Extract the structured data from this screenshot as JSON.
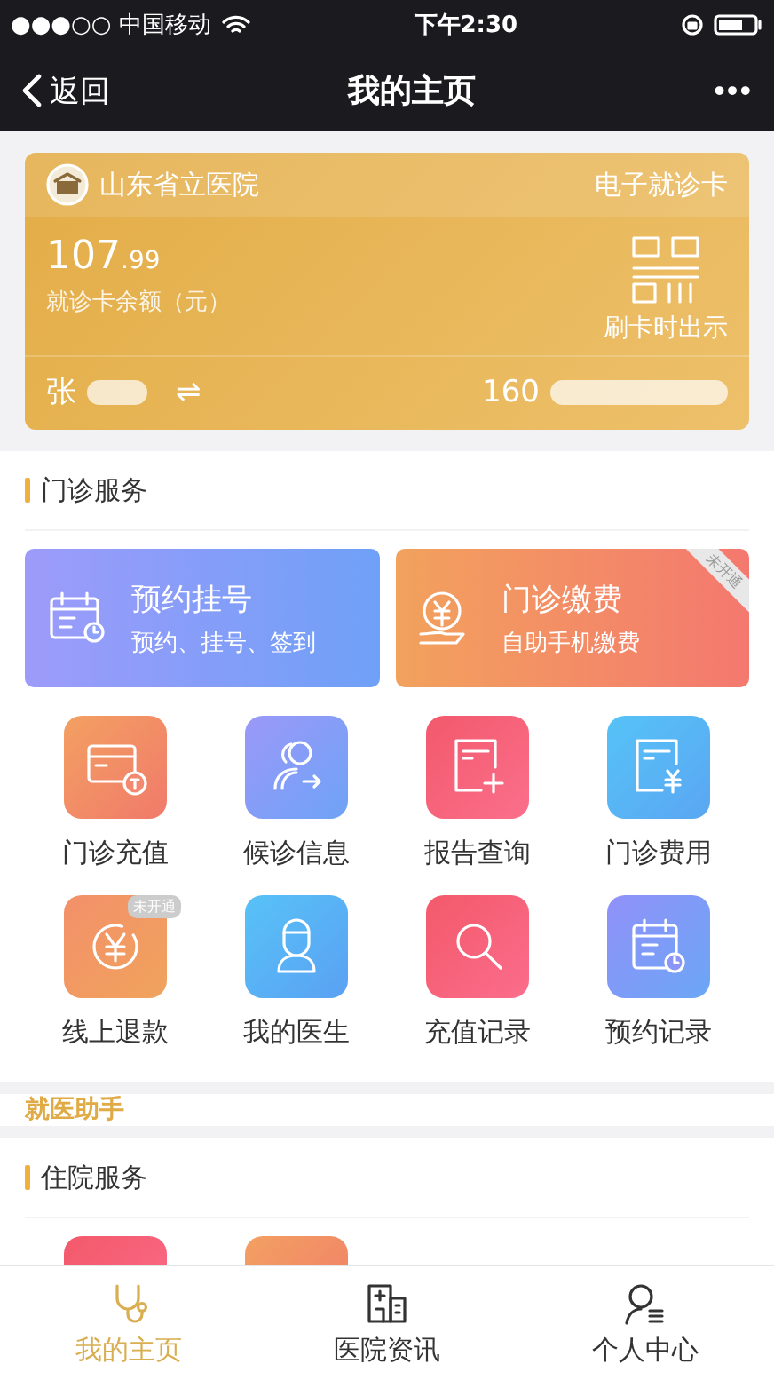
{
  "status_bar": {
    "carrier": "●●●○○ 中国移动",
    "time": "下午2:30"
  },
  "nav": {
    "back": "返回",
    "title": "我的主页",
    "more": "•••"
  },
  "card": {
    "hospital": "山东省立医院",
    "card_type": "电子就诊卡",
    "balance_int": "107",
    "balance_dec": ".99",
    "balance_label": "就诊卡余额（元）",
    "qr_hint": "刷卡时出示",
    "holder": "张",
    "swap": "⇌",
    "card_number": "160"
  },
  "outpatient": {
    "title": "门诊服务",
    "banners": [
      {
        "title": "预约挂号",
        "subtitle": "预约、挂号、签到"
      },
      {
        "title": "门诊缴费",
        "subtitle": "自助手机缴费",
        "badge": "未开通"
      }
    ],
    "tiles": [
      {
        "label": "门诊充值"
      },
      {
        "label": "候诊信息"
      },
      {
        "label": "报告查询"
      },
      {
        "label": "门诊费用"
      },
      {
        "label": "线上退款",
        "badge": "未开通"
      },
      {
        "label": "我的医生"
      },
      {
        "label": "充值记录"
      },
      {
        "label": "预约记录"
      }
    ]
  },
  "assistant": {
    "title": "就医助手"
  },
  "inpatient": {
    "title": "住院服务"
  },
  "tab_bar": [
    {
      "label": "我的主页",
      "selected": true
    },
    {
      "label": "医院资讯",
      "selected": false
    },
    {
      "label": "个人中心",
      "selected": false
    }
  ]
}
